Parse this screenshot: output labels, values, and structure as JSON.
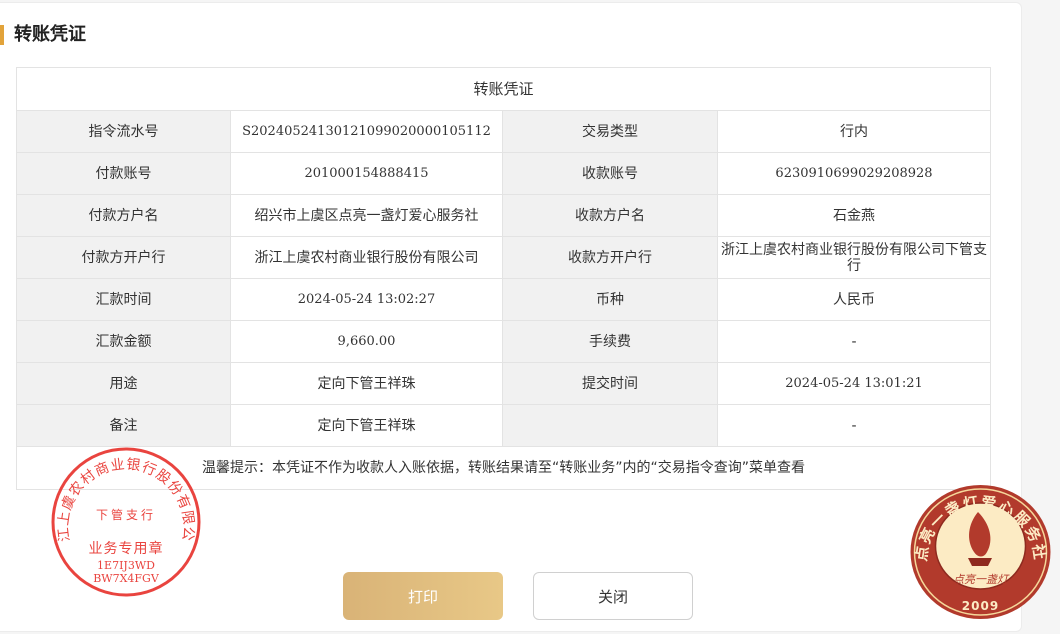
{
  "page": {
    "title": "转账凭证"
  },
  "voucher": {
    "caption": "转账凭证",
    "rows": [
      {
        "l1": "指令流水号",
        "v1": "S20240524130121099020000105112",
        "l2": "交易类型",
        "v2": "行内"
      },
      {
        "l1": "付款账号",
        "v1": "201000154888415",
        "l2": "收款账号",
        "v2": "6230910699029208928"
      },
      {
        "l1": "付款方户名",
        "v1": "绍兴市上虞区点亮一盏灯爱心服务社",
        "l2": "收款方户名",
        "v2": "石金燕"
      },
      {
        "l1": "付款方开户行",
        "v1": "浙江上虞农村商业银行股份有限公司",
        "l2": "收款方开户行",
        "v2": "浙江上虞农村商业银行股份有限公司下管支行"
      },
      {
        "l1": "汇款时间",
        "v1": "2024-05-24 13:02:27",
        "l2": "币种",
        "v2": "人民币"
      },
      {
        "l1": "汇款金额",
        "v1": "9,660.00",
        "l2": "手续费",
        "v2": "-"
      },
      {
        "l1": "用途",
        "v1": "定向下管王祥珠",
        "l2": "提交时间",
        "v2": "2024-05-24 13:01:21"
      },
      {
        "l1": "备注",
        "v1": "定向下管王祥珠",
        "l2": "",
        "v2": "-"
      }
    ],
    "tip": "温馨提示：本凭证不作为收款人入账依据，转账结果请至“转账业务”内的“交易指令查询”菜单查看"
  },
  "buttons": {
    "print": "打印",
    "close": "关闭"
  },
  "seal_bank": {
    "ring_text": "浙江上虞农村商业银行股份有限公司",
    "branch": "下管支行",
    "purpose": "业务专用章",
    "code1": "1E7IJ3WD",
    "code2": "BW7X4FGV",
    "color": "#e8352f"
  },
  "seal_org": {
    "ring_text": "点亮一盏灯爱心服务社",
    "center_text": "点亮一盏灯",
    "year": "2009",
    "ring_color": "#b23a2c",
    "fill_color": "#fcebc4"
  }
}
